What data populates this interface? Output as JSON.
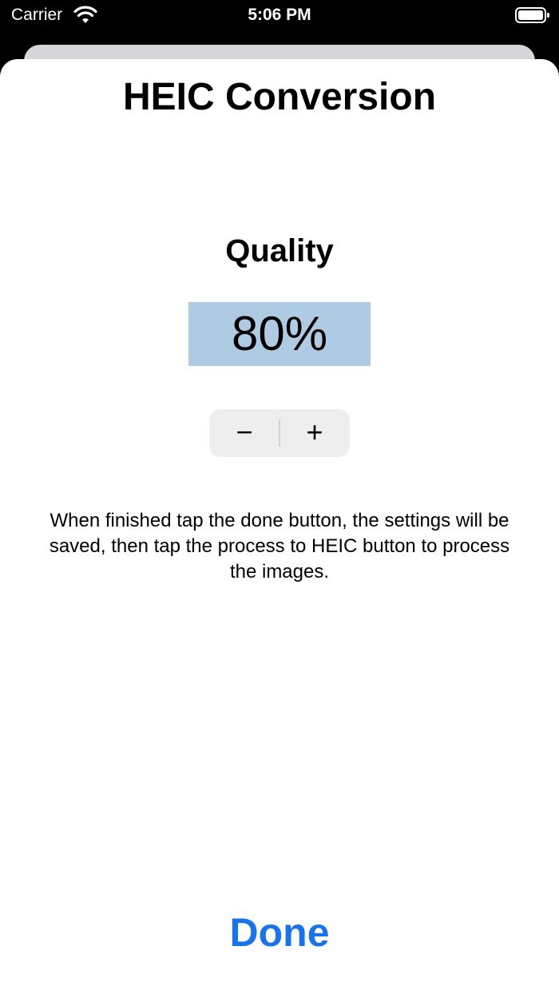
{
  "status_bar": {
    "carrier": "Carrier",
    "time": "5:06 PM",
    "wifi_icon": "wifi-icon",
    "battery_icon": "battery-icon"
  },
  "screen": {
    "title": "HEIC Conversion",
    "quality_label": "Quality",
    "quality_value": "80%",
    "stepper": {
      "minus_label": "−",
      "plus_label": "+"
    },
    "instructions": "When finished tap the done button, the settings will be saved, then tap the process to HEIC button to process the images.",
    "done_label": "Done"
  },
  "colors": {
    "accent": "#1a73e8",
    "value_highlight": "#aecbe3",
    "stepper_bg": "#eeeeef"
  }
}
